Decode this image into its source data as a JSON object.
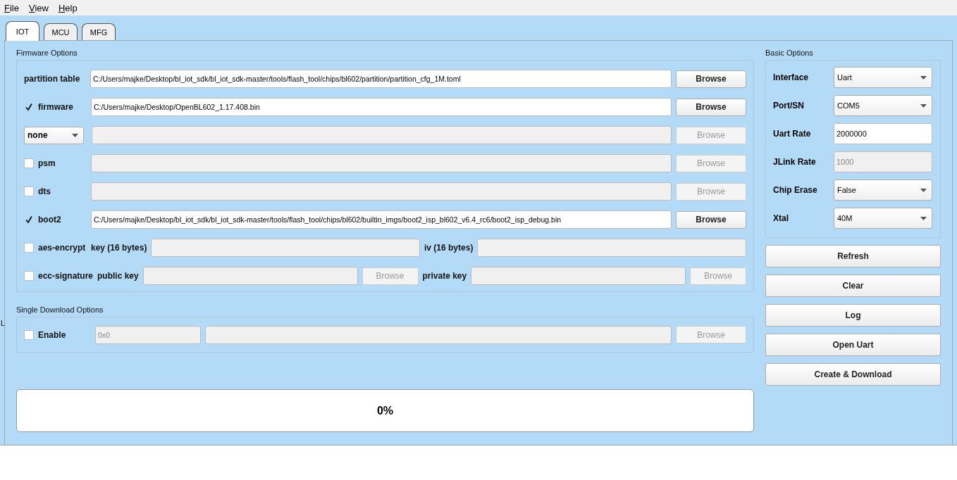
{
  "menu": [
    {
      "label": "File"
    },
    {
      "label": "View"
    },
    {
      "label": "Help"
    }
  ],
  "tabs": [
    {
      "label": "IOT",
      "selected": true
    },
    {
      "label": "MCU",
      "selected": false
    },
    {
      "label": "MFG",
      "selected": false
    }
  ],
  "firmware_options": {
    "title": "Firmware Options",
    "rows": [
      {
        "items": [
          {
            "kind": "label",
            "text": "partition table"
          },
          {
            "kind": "field",
            "value": "C:/Users/majke/Desktop/bl_iot_sdk/bl_iot_sdk-master/tools/flash_tool/chips/bl602/partition/partition_cfg_1M.toml",
            "disabled": false
          },
          {
            "kind": "button",
            "label": "Browse",
            "disabled": false
          }
        ]
      },
      {
        "items": [
          {
            "kind": "checkbox",
            "label": "firmware",
            "checked": true
          },
          {
            "kind": "field",
            "value": "C:/Users/majke/Desktop/OpenBL602_1.17.408.bin",
            "disabled": false
          },
          {
            "kind": "button",
            "label": "Browse",
            "disabled": false
          }
        ]
      },
      {
        "items": [
          {
            "kind": "select",
            "value": "none"
          },
          {
            "kind": "field",
            "disabled": true
          },
          {
            "kind": "button",
            "label": "Browse",
            "disabled": true
          }
        ]
      },
      {
        "items": [
          {
            "kind": "checkbox",
            "label": "psm",
            "checked": false
          },
          {
            "kind": "field",
            "disabled": true
          },
          {
            "kind": "button",
            "label": "Browse",
            "disabled": true
          }
        ]
      },
      {
        "items": [
          {
            "kind": "checkbox",
            "label": "dts",
            "checked": false
          },
          {
            "kind": "field",
            "disabled": true
          },
          {
            "kind": "button",
            "label": "Browse",
            "disabled": true
          }
        ]
      },
      {
        "items": [
          {
            "kind": "checkbox",
            "label": "boot2",
            "checked": true
          },
          {
            "kind": "field",
            "value": "C:/Users/majke/Desktop/bl_iot_sdk/bl_iot_sdk-master/tools/flash_tool/chips/bl602/builtin_imgs/boot2_isp_bl602_v6.4_rc6/boot2_isp_debug.bin",
            "disabled": false
          },
          {
            "kind": "button",
            "label": "Browse",
            "disabled": false
          }
        ]
      },
      {
        "items": [
          {
            "kind": "checkbox",
            "label": "aes-encrypt",
            "checked": false
          },
          {
            "kind": "label",
            "text": "key (16 bytes)"
          },
          {
            "kind": "field",
            "disabled": true
          },
          {
            "kind": "label",
            "text": "iv (16 bytes)"
          },
          {
            "kind": "field",
            "disabled": true
          }
        ]
      },
      {
        "items": [
          {
            "kind": "checkbox",
            "label": "ecc-signature",
            "checked": false
          },
          {
            "kind": "label",
            "text": "public key"
          },
          {
            "kind": "field",
            "disabled": true
          },
          {
            "kind": "smallbutton",
            "label": "Browse",
            "disabled": true
          },
          {
            "kind": "label",
            "text": "private key"
          },
          {
            "kind": "field",
            "disabled": true
          },
          {
            "kind": "smallbutton",
            "label": "Browse",
            "disabled": true
          }
        ]
      }
    ]
  },
  "single_download": {
    "title": "Single Download Options",
    "side_mark": "L",
    "items": [
      {
        "kind": "checkbox",
        "label": "Enable",
        "checked": false
      },
      {
        "kind": "shortfield",
        "value": "0x0",
        "disabled": true
      },
      {
        "kind": "field",
        "disabled": true
      },
      {
        "kind": "button",
        "label": "Browse",
        "disabled": true
      }
    ]
  },
  "progress": {
    "text": "0%",
    "level": 0
  },
  "basic_options": {
    "title": "Basic Options",
    "rows": [
      {
        "label": "Interface",
        "kind": "select",
        "value": "Uart",
        "disabled": false
      },
      {
        "label": "Port/SN",
        "kind": "select",
        "value": "COM5",
        "disabled": false
      },
      {
        "label": "Uart Rate",
        "kind": "field",
        "value": "2000000",
        "disabled": false
      },
      {
        "label": "JLink Rate",
        "kind": "field",
        "value": "1000",
        "disabled": true
      },
      {
        "label": "Chip Erase",
        "kind": "select",
        "value": "False",
        "disabled": false
      },
      {
        "label": "Xtal",
        "kind": "select",
        "value": "40M",
        "disabled": false
      }
    ]
  },
  "actions": [
    "Refresh",
    "Clear",
    "Log",
    "Open Uart",
    "Create & Download"
  ]
}
